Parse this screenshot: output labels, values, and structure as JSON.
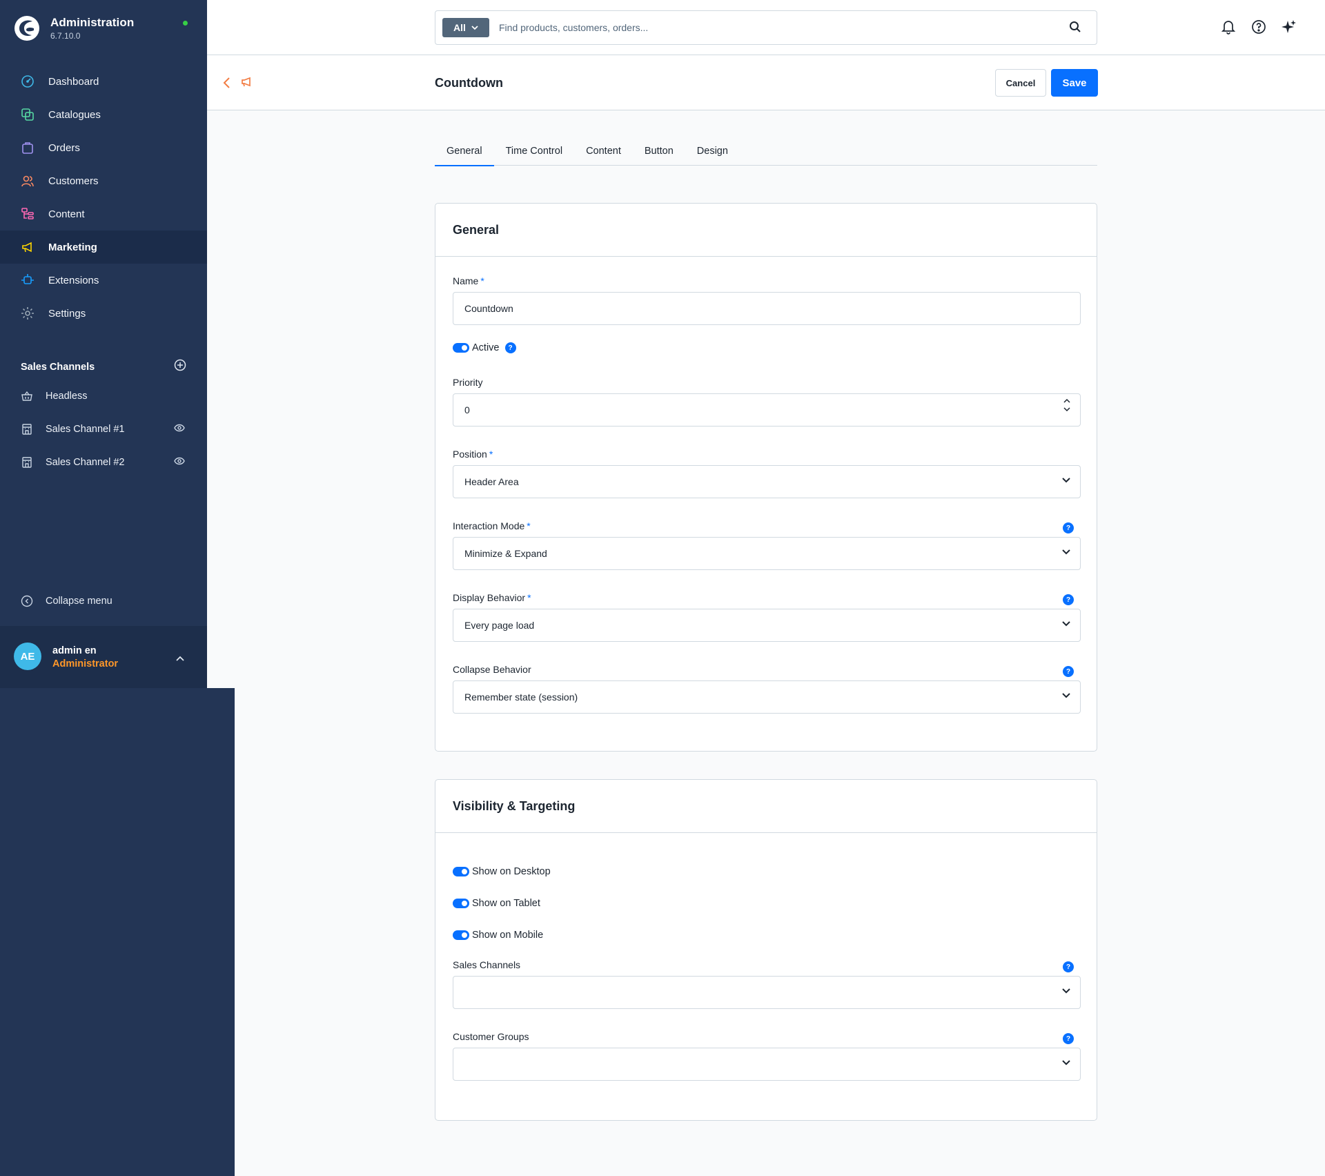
{
  "app": {
    "title": "Administration",
    "version": "6.7.10.0"
  },
  "sidebar": {
    "items": [
      {
        "label": "Dashboard",
        "icon": "dashboard-icon",
        "color": "#3fb9e8"
      },
      {
        "label": "Catalogues",
        "icon": "catalogues-icon",
        "color": "#57d9a3"
      },
      {
        "label": "Orders",
        "icon": "orders-icon",
        "color": "#a092f0"
      },
      {
        "label": "Customers",
        "icon": "customers-icon",
        "color": "#f88962"
      },
      {
        "label": "Content",
        "icon": "content-icon",
        "color": "#ff68b4"
      },
      {
        "label": "Marketing",
        "icon": "marketing-icon",
        "color": "#ffd700",
        "active": true
      },
      {
        "label": "Extensions",
        "icon": "extensions-icon",
        "color": "#189eff"
      },
      {
        "label": "Settings",
        "icon": "settings-icon",
        "color": "#9aa8b5"
      }
    ],
    "sales_channels_title": "Sales Channels",
    "sales_channels": [
      {
        "label": "Headless",
        "icon": "basket-icon"
      },
      {
        "label": "Sales Channel #1",
        "icon": "storefront-icon"
      },
      {
        "label": "Sales Channel #2",
        "icon": "storefront-icon"
      }
    ],
    "collapse_label": "Collapse menu",
    "user": {
      "initials": "AE",
      "name": "admin en",
      "role": "Administrator"
    }
  },
  "search": {
    "type_label": "All",
    "placeholder": "Find products, customers, orders..."
  },
  "page": {
    "title": "Countdown",
    "cancel_label": "Cancel",
    "save_label": "Save"
  },
  "tabs": [
    "General",
    "Time Control",
    "Content",
    "Button",
    "Design"
  ],
  "general": {
    "title": "General",
    "name_label": "Name",
    "name_value": "Countdown",
    "active_label": "Active",
    "priority_label": "Priority",
    "priority_value": "0",
    "position_label": "Position",
    "position_value": "Header Area",
    "interaction_label": "Interaction Mode",
    "interaction_value": "Minimize & Expand",
    "display_label": "Display Behavior",
    "display_value": "Every page load",
    "collapse_label": "Collapse Behavior",
    "collapse_value": "Remember state (session)"
  },
  "visibility": {
    "title": "Visibility & Targeting",
    "desktop_label": "Show on Desktop",
    "tablet_label": "Show on Tablet",
    "mobile_label": "Show on Mobile",
    "sales_channels_label": "Sales Channels",
    "sales_channels_value": "",
    "customer_groups_label": "Customer Groups",
    "customer_groups_value": ""
  },
  "help_glyph": "?",
  "required_glyph": "*",
  "colors": {
    "sidebar": "#233555",
    "accent": "#0870ff",
    "role": "#ff9729",
    "status": "#37d046"
  }
}
